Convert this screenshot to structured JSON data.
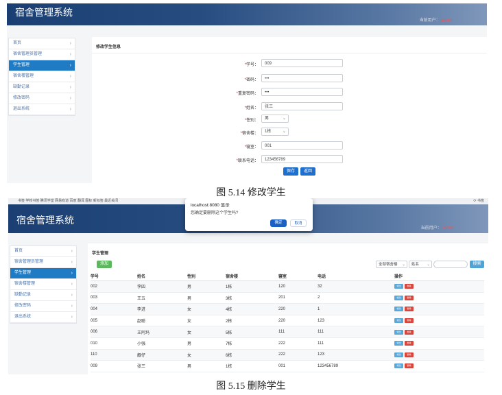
{
  "app_title": "宿舍管理系统",
  "header_user_label": "当前用户：",
  "header_user_name": "admin",
  "sidebar": {
    "items": [
      {
        "label": "首页"
      },
      {
        "label": "宿舍管理员管理"
      },
      {
        "label": "学生管理"
      },
      {
        "label": "宿舍楼管理"
      },
      {
        "label": "缺勤记录"
      },
      {
        "label": "修改密码"
      },
      {
        "label": "退出系统"
      }
    ],
    "active_index": 2,
    "chevron": "›"
  },
  "edit_screen": {
    "panel_title": "修改学生信息",
    "fields": {
      "student_id": {
        "label": "学号：",
        "value": "009"
      },
      "password": {
        "label": "密码：",
        "value": "•••"
      },
      "repeat_password": {
        "label": "重复密码：",
        "value": "•••"
      },
      "name": {
        "label": "姓名：",
        "value": "张三"
      },
      "gender": {
        "label": "性别：",
        "value": "男"
      },
      "building": {
        "label": "宿舍楼：",
        "value": "1栋"
      },
      "room": {
        "label": "寝室：",
        "value": "001"
      },
      "phone": {
        "label": "联系电话：",
        "value": "123456789"
      }
    },
    "required_mark": "*",
    "save_label": "保存",
    "back_label": "返回"
  },
  "caption_1": "图 5.14    修改学生",
  "browser_bar_text": "书签   学校书签   腾讯学堂   网易有道   百度   翻译   图标   新标签   最近关闭",
  "browser_bar_right": "⟳ 书签",
  "dialog": {
    "title": "localhost:8080 显示",
    "message": "您确定要删除这个学生吗?",
    "ok_label": "确定",
    "cancel_label": "取消"
  },
  "list_screen": {
    "panel_title": "学生管理",
    "add_label": "添加",
    "filter_building": "全部宿舍楼",
    "filter_field": "姓名",
    "search_label": "搜索",
    "columns": [
      "学号",
      "姓名",
      "性别",
      "宿舍楼",
      "寝室",
      "电话",
      "操作"
    ],
    "rows": [
      [
        "002",
        "李四",
        "男",
        "1栋",
        "120",
        "32"
      ],
      [
        "003",
        "王五",
        "男",
        "3栋",
        "201",
        "2"
      ],
      [
        "004",
        "李进",
        "女",
        "4栋",
        "220",
        "1"
      ],
      [
        "005",
        "赵聪",
        "女",
        "2栋",
        "220",
        "123"
      ],
      [
        "006",
        "王阿玛",
        "女",
        "5栋",
        "111",
        "111"
      ],
      [
        "010",
        "小强",
        "男",
        "7栋",
        "222",
        "111"
      ],
      [
        "110",
        "靓仔",
        "女",
        "6栋",
        "222",
        "123"
      ],
      [
        "009",
        "张三",
        "男",
        "1栋",
        "001",
        "123456789"
      ]
    ],
    "edit_label": "修改",
    "delete_label": "删除"
  },
  "caption_2": "图 5.15    删除学生",
  "colors": {
    "header_start": "#1b3f72",
    "sidebar_active": "#1f7bc4",
    "primary_button": "#1f6fcf",
    "add_button": "#5cb85c",
    "delete_button": "#d9443b"
  }
}
